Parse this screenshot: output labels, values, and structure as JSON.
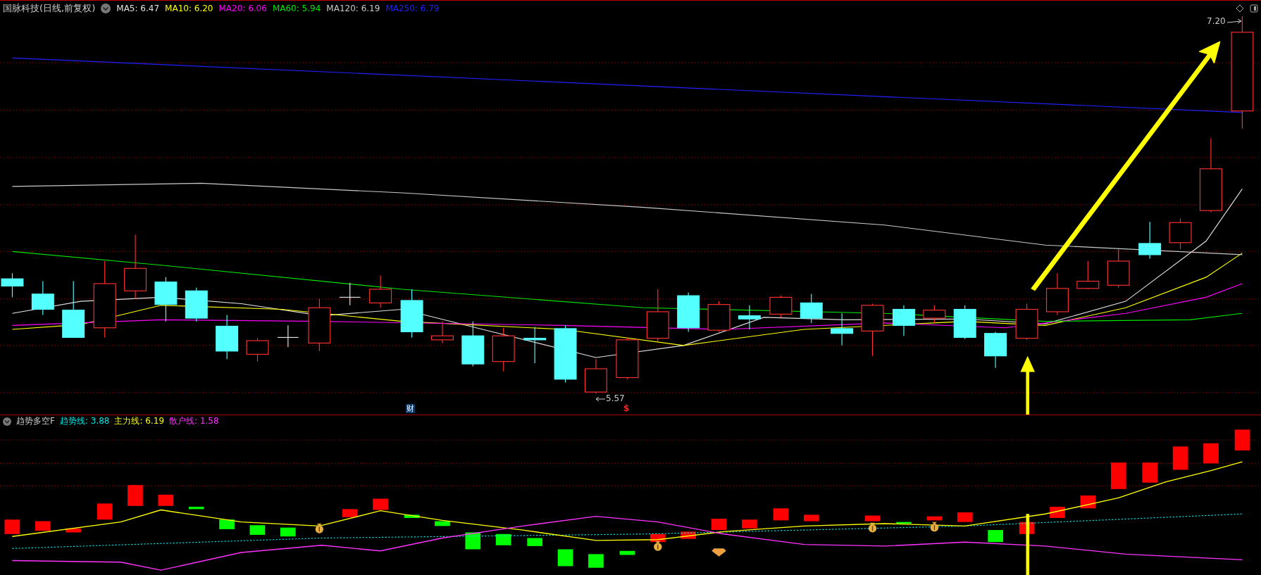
{
  "header": {
    "title": "国脉科技(日线,前复权)",
    "ma_lines": [
      {
        "text": "MA5: 6.47",
        "color": "#e0e0e0"
      },
      {
        "text": "MA10: 6.20",
        "color": "#ffff00"
      },
      {
        "text": "MA20: 6.06",
        "color": "#ff00ff"
      },
      {
        "text": "MA60: 5.94",
        "color": "#00e600"
      },
      {
        "text": "MA120: 6.19",
        "color": "#c8c8c8"
      },
      {
        "text": "MA250: 6.79",
        "color": "#2020ff"
      }
    ]
  },
  "price_chart": {
    "high_label": "7.20",
    "low_label": "5.57",
    "event_badge": "财",
    "dividend_mark": "$"
  },
  "indicator": {
    "title": "趋势多空F",
    "lines": [
      {
        "text": "趋势线: 3.88",
        "color": "#00e5e5"
      },
      {
        "text": "主力线: 6.19",
        "color": "#ffff00"
      },
      {
        "text": "散户线: 1.58",
        "color": "#ff33ff"
      }
    ]
  }
}
